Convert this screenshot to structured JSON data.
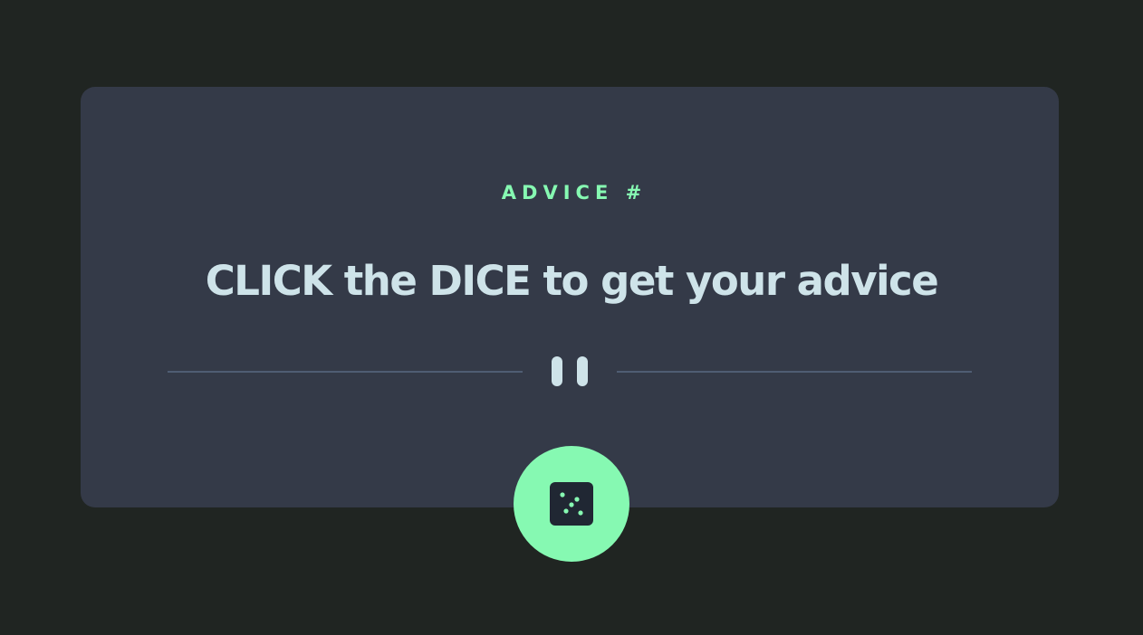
{
  "advice": {
    "id_label": "ADVICE #",
    "text": "CLICK the DICE to get your advice"
  },
  "icons": {
    "divider": "pause-icon",
    "button": "dice-icon"
  },
  "colors": {
    "background": "#202522",
    "card": "#343a48",
    "accent": "#86f9b2",
    "text": "#cee3e9",
    "divider": "#4f5d73",
    "dice_face": "#202733"
  }
}
